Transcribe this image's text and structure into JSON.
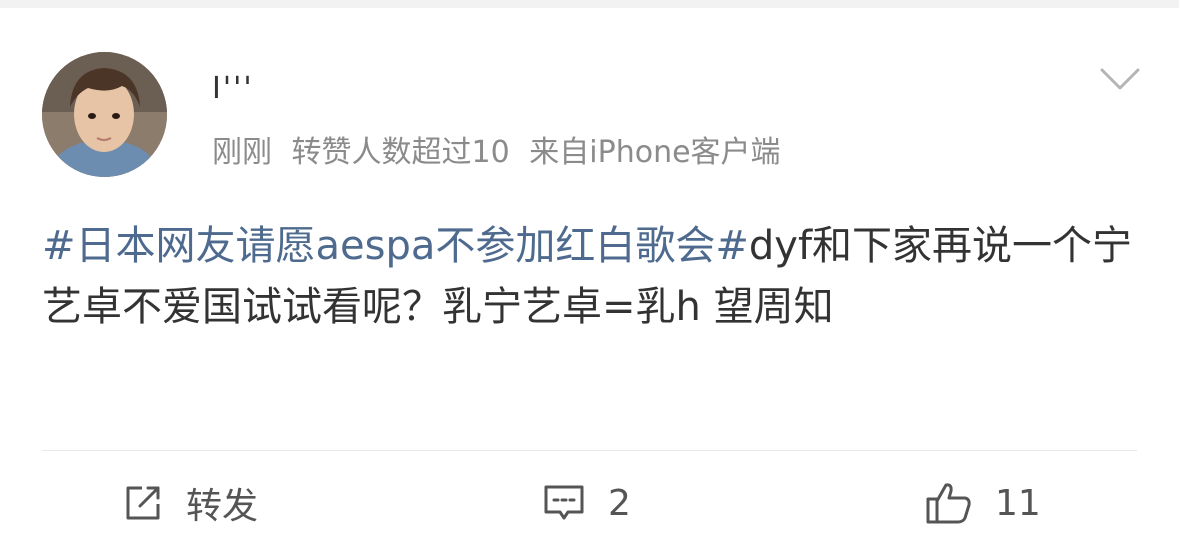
{
  "post": {
    "username": "I'''",
    "meta": {
      "time": "刚刚",
      "reposts_note": "转赞人数超过10",
      "source": "来自iPhone客户端"
    },
    "content": {
      "hashtag": "#日本网友请愿aespa不参加红白歌会#",
      "text": "dyf和下家再说一个宁艺卓不爱国试试看呢？乳宁艺卓=乳h 望周知"
    }
  },
  "actions": {
    "repost_label": "转发",
    "comment_count": "2",
    "like_count": "11"
  },
  "icons": {
    "menu": "chevron-down-icon",
    "repost": "repost-icon",
    "comment": "comment-icon",
    "like": "thumbs-up-icon"
  },
  "colors": {
    "hashtag": "#4e6a8e",
    "meta": "#8b8b8b",
    "text": "#333333"
  }
}
